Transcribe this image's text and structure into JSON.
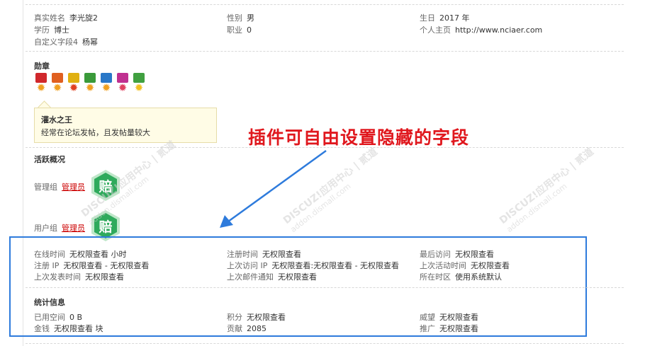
{
  "profile": {
    "real_name": {
      "label": "真实姓名",
      "value": "李光旋2"
    },
    "gender": {
      "label": "性别",
      "value": "男"
    },
    "birthday": {
      "label": "生日",
      "value": "2017 年"
    },
    "education": {
      "label": "学历",
      "value": "博士"
    },
    "occupation": {
      "label": "职业",
      "value": "0"
    },
    "homepage": {
      "label": "个人主页",
      "value": "http://www.nciaer.com"
    },
    "custom_field": {
      "label": "自定义字段4",
      "value": "杨幂"
    }
  },
  "medals": {
    "title": "勋章",
    "items": [
      {
        "icon": "medal-icon",
        "ribbon": "#d0282c",
        "accent": "#f0a020"
      },
      {
        "icon": "medal-icon",
        "ribbon": "#e06020",
        "accent": "#f0a020"
      },
      {
        "icon": "medal-icon",
        "ribbon": "#e0b010",
        "accent": "#e04020"
      },
      {
        "icon": "medal-icon",
        "ribbon": "#3a9a3a",
        "accent": "#f0a020"
      },
      {
        "icon": "medal-icon",
        "ribbon": "#2a78c8",
        "accent": "#f0a020"
      },
      {
        "icon": "medal-icon",
        "ribbon": "#c03090",
        "accent": "#e04060"
      },
      {
        "icon": "medal-icon",
        "ribbon": "#40a040",
        "accent": "#f0c020"
      }
    ],
    "tooltip": {
      "title": "灌水之王",
      "desc": "经常在论坛发帖，且发帖量较大"
    }
  },
  "activity": {
    "title": "活跃概况",
    "admin_group": {
      "label": "管理组",
      "value": "管理员"
    },
    "user_group": {
      "label": "用户组",
      "value": "管理员"
    },
    "badge_char": "赔",
    "badge_color": "#2faa5c"
  },
  "annotation": {
    "text": "插件可自由设置隐藏的字段",
    "color": "#e0181e",
    "box_color": "#2e7bdc"
  },
  "online": {
    "online_time": {
      "label": "在线时间",
      "value": "无权限查看 小时"
    },
    "register_time": {
      "label": "注册时间",
      "value": "无权限查看"
    },
    "last_visit": {
      "label": "最后访问",
      "value": "无权限查看"
    },
    "register_ip": {
      "label": "注册 IP",
      "value": "无权限查看 - 无权限查看"
    },
    "last_visit_ip": {
      "label": "上次访问 IP",
      "value": "无权限查看:无权限查看 - 无权限查看"
    },
    "last_active": {
      "label": "上次活动时间",
      "value": "无权限查看"
    },
    "last_post": {
      "label": "上次发表时间",
      "value": "无权限查看"
    },
    "last_mail": {
      "label": "上次邮件通知",
      "value": "无权限查看"
    },
    "timezone": {
      "label": "所在时区",
      "value": "使用系统默认"
    }
  },
  "stats": {
    "title": "统计信息",
    "space": {
      "label": "已用空间",
      "value": "0 B"
    },
    "credits": {
      "label": "积分",
      "value": "无权限查看"
    },
    "prestige": {
      "label": "威望",
      "value": "无权限查看"
    },
    "money": {
      "label": "金钱",
      "value": "无权限查看 块"
    },
    "contribution": {
      "label": "贡献",
      "value": "2085"
    },
    "promotion": {
      "label": "推广",
      "value": "无权限查看"
    }
  },
  "watermark": {
    "brand": "DISCUZ!应用中心 | 贰道",
    "url": "addon.dismall.com"
  }
}
